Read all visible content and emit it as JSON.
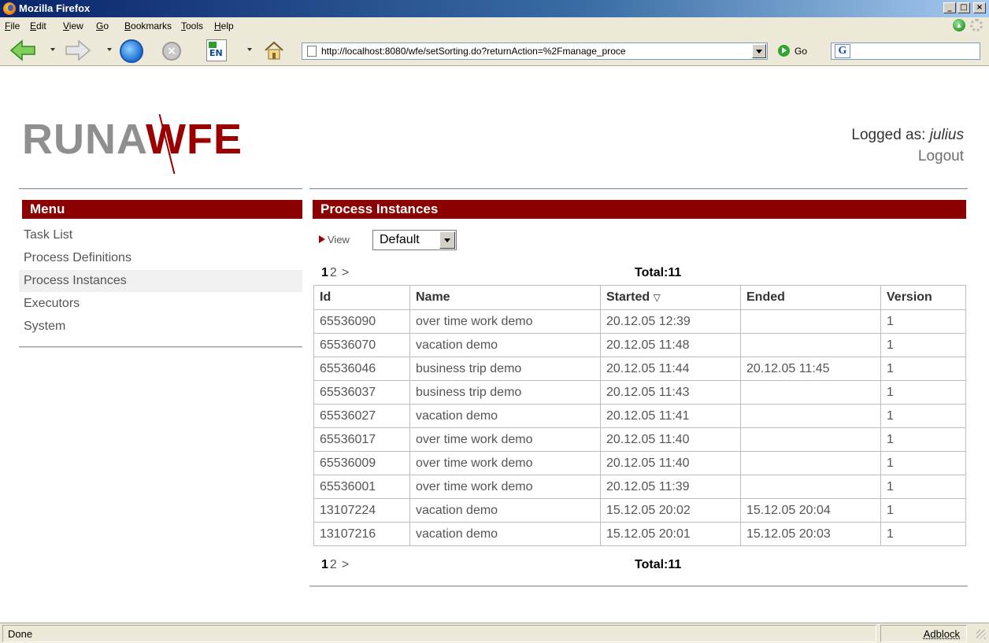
{
  "window": {
    "title": "Mozilla Firefox",
    "buttons": {
      "minimize": "_",
      "maximize": "□",
      "close": "×"
    }
  },
  "menubar": {
    "items": [
      "File",
      "Edit",
      "View",
      "Go",
      "Bookmarks",
      "Tools",
      "Help"
    ]
  },
  "navbar": {
    "url": "http://localhost:8080/wfe/setSorting.do?returnAction=%2Fmanage_proce",
    "go_label": "Go",
    "lang_label": "EN",
    "search_icon": "G"
  },
  "header": {
    "logo_part1": "RUNA",
    "logo_part2": "WFE",
    "logged_prefix": "Logged as: ",
    "username": "julius",
    "logout_label": "Logout"
  },
  "menu": {
    "title": "Menu",
    "items": [
      {
        "label": "Task List"
      },
      {
        "label": "Process Definitions"
      },
      {
        "label": "Process Instances",
        "active": true
      },
      {
        "label": "Executors"
      },
      {
        "label": "System"
      }
    ]
  },
  "main": {
    "title": "Process Instances",
    "view_label": "View",
    "view_value": "Default",
    "pager": {
      "current": "1",
      "next_page": "2",
      "next_arrow": ">"
    },
    "total_text": "Total:11",
    "columns": [
      "Id",
      "Name",
      "Started",
      "Ended",
      "Version"
    ],
    "sort_indicator": "▽",
    "rows": [
      [
        "65536090",
        "over time work demo",
        "20.12.05 12:39",
        "",
        "1"
      ],
      [
        "65536070",
        "vacation demo",
        "20.12.05 11:48",
        "",
        "1"
      ],
      [
        "65536046",
        "business trip demo",
        "20.12.05 11:44",
        "20.12.05 11:45",
        "1"
      ],
      [
        "65536037",
        "business trip demo",
        "20.12.05 11:43",
        "",
        "1"
      ],
      [
        "65536027",
        "vacation demo",
        "20.12.05 11:41",
        "",
        "1"
      ],
      [
        "65536017",
        "over time work demo",
        "20.12.05 11:40",
        "",
        "1"
      ],
      [
        "65536009",
        "over time work demo",
        "20.12.05 11:40",
        "",
        "1"
      ],
      [
        "65536001",
        "over time work demo",
        "20.12.05 11:39",
        "",
        "1"
      ],
      [
        "13107224",
        "vacation demo",
        "15.12.05 20:02",
        "15.12.05 20:04",
        "1"
      ],
      [
        "13107216",
        "vacation demo",
        "15.12.05 20:01",
        "15.12.05 20:03",
        "1"
      ]
    ]
  },
  "statusbar": {
    "status": "Done",
    "adblock": "Adblock"
  },
  "colors": {
    "brand_red": "#8b0000",
    "logo_gray": "#8f8f8f"
  }
}
